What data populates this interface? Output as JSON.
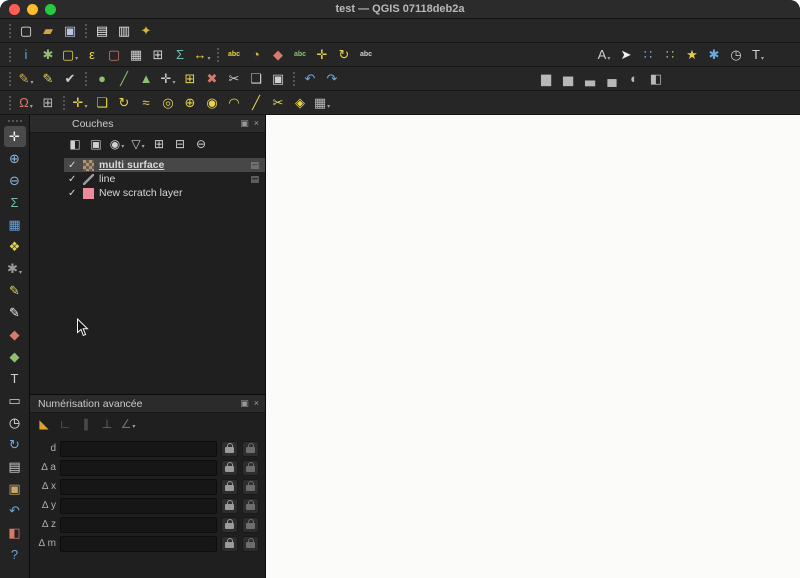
{
  "window": {
    "title": "test — QGIS 07118deb2a"
  },
  "panel_controls": {
    "float": "▣",
    "close": "×"
  },
  "toolbars": {
    "row1": [
      [
        {
          "name": "new-project-icon",
          "glyph": "▢",
          "color": "#e8e8e8"
        },
        {
          "name": "open-project-icon",
          "glyph": "▰",
          "color": "#d9a33b"
        },
        {
          "name": "save-project-icon",
          "glyph": "▣",
          "color": "#b9c4e0"
        }
      ],
      [
        {
          "name": "new-print-layout-icon",
          "glyph": "▤",
          "color": "#e8e8e8"
        },
        {
          "name": "layout-manager-icon",
          "glyph": "▥",
          "color": "#e8e8e8"
        },
        {
          "name": "style-manager-icon",
          "glyph": "✦",
          "color": "#d9b33b"
        }
      ]
    ],
    "row2": [
      [
        {
          "name": "identify-features-icon",
          "glyph": "i",
          "color": "#5fa8dc"
        },
        {
          "name": "run-feature-action-icon",
          "glyph": "✱",
          "color": "#8fbf6f"
        },
        {
          "name": "select-features-icon",
          "glyph": "▢",
          "color": "#e8d44a",
          "dd": true
        },
        {
          "name": "select-by-expression-icon",
          "glyph": "ε",
          "color": "#e8d44a"
        },
        {
          "name": "deselect-features-icon",
          "glyph": "▢",
          "color": "#d87a6a"
        },
        {
          "name": "open-attribute-table-icon",
          "glyph": "▦",
          "color": "#d0d0d0"
        },
        {
          "name": "field-calculator-icon",
          "glyph": "⊞",
          "color": "#d0d0d0"
        },
        {
          "name": "statistical-summary-icon",
          "glyph": "Σ",
          "color": "#6fbfae"
        },
        {
          "name": "measure-icon",
          "glyph": "↔",
          "color": "#e8d44a",
          "dd": true
        }
      ],
      [
        {
          "name": "layer-labeling-icon",
          "glyph": "abc",
          "color": "#e8d44a"
        },
        {
          "name": "layer-diagram-icon",
          "glyph": "◔",
          "color": "#e8b34a"
        },
        {
          "name": "pin-labels-icon",
          "glyph": "◆",
          "color": "#d87a6a"
        },
        {
          "name": "highlight-labels-icon",
          "glyph": "abc",
          "color": "#8fbf6f"
        },
        {
          "name": "move-label-icon",
          "glyph": "✛",
          "color": "#e8d44a"
        },
        {
          "name": "rotate-label-icon",
          "glyph": "↻",
          "color": "#e8d44a"
        },
        {
          "name": "change-label-icon",
          "glyph": "abc",
          "color": "#d0d0d0"
        }
      ],
      [
        {
          "name": "annotation-toolbar-icon",
          "glyph": "A",
          "color": "#d0d0d0",
          "dd": true
        },
        {
          "name": "select-pointer-icon",
          "glyph": "➤",
          "color": "#f0f0f0"
        },
        {
          "name": "point-cluster-blue-icon",
          "glyph": "∷",
          "color": "#6aa8e0"
        },
        {
          "name": "point-cluster-green-icon",
          "glyph": "∷",
          "color": "#8fbf6f"
        },
        {
          "name": "new-shapefile-star-icon",
          "glyph": "★",
          "color": "#e8c84a"
        },
        {
          "name": "processing-toolbox-icon",
          "glyph": "✱",
          "color": "#6aa8e0"
        },
        {
          "name": "temporal-controller-icon",
          "glyph": "◷",
          "color": "#d0d0d0"
        },
        {
          "name": "text-format-icon",
          "glyph": "T",
          "color": "#d0d0d0",
          "dd": true
        }
      ]
    ],
    "row3": [
      [
        {
          "name": "current-edits-icon",
          "glyph": "✎",
          "color": "#d9b33b",
          "dd": true
        },
        {
          "name": "toggle-editing-icon",
          "glyph": "✎",
          "color": "#e8d44a"
        },
        {
          "name": "save-layer-edits-icon",
          "glyph": "✔",
          "color": "#d0d0d0"
        }
      ],
      [
        {
          "name": "add-point-feature-icon",
          "glyph": "●",
          "color": "#8fbf6f"
        },
        {
          "name": "add-line-feature-icon",
          "glyph": "╱",
          "color": "#8fbf6f"
        },
        {
          "name": "add-polygon-feature-icon",
          "glyph": "▲",
          "color": "#8fbf6f"
        },
        {
          "name": "vertex-tool-icon",
          "glyph": "✛",
          "color": "#d0d0d0",
          "dd": true
        },
        {
          "name": "modify-attributes-icon",
          "glyph": "⊞",
          "color": "#e8d44a"
        },
        {
          "name": "delete-selected-icon",
          "glyph": "✖",
          "color": "#d87a6a"
        },
        {
          "name": "cut-features-icon",
          "glyph": "✂",
          "color": "#d0d0d0"
        },
        {
          "name": "copy-features-icon",
          "glyph": "❏",
          "color": "#d0d0d0"
        },
        {
          "name": "paste-features-icon",
          "glyph": "▣",
          "color": "#d0d0d0"
        }
      ],
      [
        {
          "name": "undo-icon",
          "glyph": "↶",
          "color": "#6aa8e0"
        },
        {
          "name": "redo-icon",
          "glyph": "↷",
          "color": "#6aa8e0"
        }
      ],
      [
        {
          "name": "raster-histogram-icon",
          "glyph": "▆",
          "color": "#b8b8b8"
        },
        {
          "name": "raster-local-histogram-icon",
          "glyph": "▅",
          "color": "#b8b8b8"
        },
        {
          "name": "raster-stretch-icon",
          "glyph": "▃",
          "color": "#b8b8b8"
        },
        {
          "name": "raster-cumulative-icon",
          "glyph": "▄",
          "color": "#b8b8b8"
        },
        {
          "name": "raster-brightness-icon",
          "glyph": "◐",
          "color": "#b8b8b8"
        },
        {
          "name": "raster-contrast-icon",
          "glyph": "◧",
          "color": "#b8b8b8"
        }
      ]
    ],
    "row4": [
      [
        {
          "name": "snapping-options-icon",
          "glyph": "Ω",
          "color": "#d87a6a",
          "dd": true
        },
        {
          "name": "snap-grid-icon",
          "glyph": "⊞",
          "color": "#b8b8b8"
        }
      ],
      [
        {
          "name": "move-feature-icon",
          "glyph": "✛",
          "color": "#e8d44a",
          "dd": true
        },
        {
          "name": "copy-move-feature-icon",
          "glyph": "❏",
          "color": "#e8d44a"
        },
        {
          "name": "rotate-feature-icon",
          "glyph": "↻",
          "color": "#e8d44a"
        },
        {
          "name": "simplify-feature-icon",
          "glyph": "≈",
          "color": "#e8d44a"
        },
        {
          "name": "add-ring-icon",
          "glyph": "◎",
          "color": "#e8d44a"
        },
        {
          "name": "add-part-icon",
          "glyph": "⊕",
          "color": "#e8d44a"
        },
        {
          "name": "fill-ring-icon",
          "glyph": "◉",
          "color": "#e8d44a"
        },
        {
          "name": "offset-curve-icon",
          "glyph": "◠",
          "color": "#e8d44a"
        },
        {
          "name": "reshape-features-icon",
          "glyph": "╱",
          "color": "#e8d44a"
        },
        {
          "name": "split-features-icon",
          "glyph": "✂",
          "color": "#e8d44a"
        },
        {
          "name": "merge-features-icon",
          "glyph": "◈",
          "color": "#e8d44a"
        },
        {
          "name": "vertex-editor-icon",
          "glyph": "▦",
          "color": "#b8b8b8",
          "dd": true
        }
      ]
    ]
  },
  "left_toolbar": [
    {
      "name": "pan-map-icon",
      "glyph": "✛",
      "color": "#f0f0f0",
      "active": true
    },
    {
      "name": "zoom-in-icon",
      "glyph": "⊕",
      "color": "#8fb8dc"
    },
    {
      "name": "zoom-out-icon",
      "glyph": "⊖",
      "color": "#8fb8dc"
    },
    {
      "name": "statistics-icon",
      "glyph": "Σ",
      "color": "#6fbfae"
    },
    {
      "name": "attribute-table-icon",
      "glyph": "▦",
      "color": "#6a9fd8"
    },
    {
      "name": "map-tips-icon",
      "glyph": "❖",
      "color": "#e8d44a"
    },
    {
      "name": "options-gear-icon",
      "glyph": "✱",
      "color": "#9a9a9a",
      "dd": true
    },
    {
      "name": "edit-pencil-icon",
      "glyph": "✎",
      "color": "#e8d44a"
    },
    {
      "name": "add-feature-pencil-icon",
      "glyph": "✎",
      "color": "#f0f0f0"
    },
    {
      "name": "marker-red-icon",
      "glyph": "◆",
      "color": "#d87a6a"
    },
    {
      "name": "marker-green-icon",
      "glyph": "◆",
      "color": "#8fbf6f"
    },
    {
      "name": "text-annotation-icon",
      "glyph": "T",
      "color": "#d0d0d0"
    },
    {
      "name": "form-annotation-icon",
      "glyph": "▭",
      "color": "#d0d0d0"
    },
    {
      "name": "temporal-clock-icon",
      "glyph": "◷",
      "color": "#f0f0f0"
    },
    {
      "name": "refresh-map-icon",
      "glyph": "↻",
      "color": "#6aa8e0"
    },
    {
      "name": "layer-stack-icon",
      "glyph": "▤",
      "color": "#d0d0d0"
    },
    {
      "name": "clipboard-icon",
      "glyph": "▣",
      "color": "#c8a86a"
    },
    {
      "name": "undo-history-icon",
      "glyph": "↶",
      "color": "#6aa8e0"
    },
    {
      "name": "style-palette-icon",
      "glyph": "◧",
      "color": "#d87a6a"
    },
    {
      "name": "help-icon",
      "glyph": "?",
      "color": "#6aa8e0"
    }
  ],
  "layers_panel": {
    "title": "Couches",
    "toolbar": [
      {
        "name": "open-layer-styling-icon",
        "glyph": "◧",
        "color": "#cfcfcf"
      },
      {
        "name": "add-group-icon",
        "glyph": "▣",
        "color": "#cfcfcf"
      },
      {
        "name": "manage-map-themes-icon",
        "glyph": "◉",
        "color": "#cfcfcf",
        "dd": true
      },
      {
        "name": "filter-legend-icon",
        "glyph": "▽",
        "color": "#cfcfcf",
        "dd": true
      },
      {
        "name": "expand-all-icon",
        "glyph": "⊞",
        "color": "#cfcfcf"
      },
      {
        "name": "collapse-all-icon",
        "glyph": "⊟",
        "color": "#cfcfcf"
      },
      {
        "name": "remove-layer-icon",
        "glyph": "⊖",
        "color": "#cfcfcf"
      }
    ],
    "layers": [
      {
        "name": "multi surface",
        "checked": true,
        "selected": true,
        "swatch": "raster",
        "indicator": "▤"
      },
      {
        "name": "line",
        "checked": true,
        "selected": false,
        "swatch": "line",
        "indicator": "▤"
      },
      {
        "name": "New scratch layer",
        "checked": true,
        "selected": false,
        "swatch": "#ef8a9b",
        "indicator": ""
      }
    ]
  },
  "advanced_panel": {
    "title": "Numérisation avancée",
    "toolbar": [
      {
        "name": "enable-advanced-digitizing-icon",
        "glyph": "◣",
        "color": "#e0a030"
      },
      {
        "name": "construction-mode-icon",
        "glyph": "∟",
        "color": "#6e6e6e"
      },
      {
        "name": "parallel-icon",
        "glyph": "∥",
        "color": "#6e6e6e"
      },
      {
        "name": "perpendicular-icon",
        "glyph": "⊥",
        "color": "#6e6e6e"
      },
      {
        "name": "snap-to-angles-icon",
        "glyph": "∠",
        "color": "#6e6e6e",
        "dd": true
      }
    ],
    "rows": [
      {
        "label": "d"
      },
      {
        "label": "∆ a"
      },
      {
        "label": "∆ x"
      },
      {
        "label": "∆ y"
      },
      {
        "label": "∆ z"
      },
      {
        "label": "∆ m"
      }
    ]
  }
}
